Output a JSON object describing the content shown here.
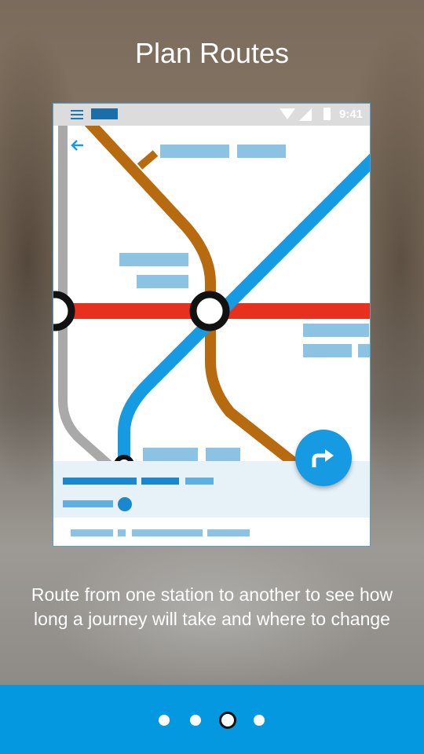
{
  "screen": {
    "title": "Plan Routes",
    "description": "Route from one station to another to see how long a journey will take and where to change"
  },
  "phone_mockup": {
    "status_time": "9:41",
    "icons": [
      "menu-icon",
      "wifi-icon",
      "signal-icon",
      "battery-icon",
      "back-arrow-icon",
      "directions-icon"
    ]
  },
  "page_indicator": {
    "total": 4,
    "active_index": 2
  },
  "colors": {
    "accent_blue": "#0398e0",
    "line_blue": "#169ae1",
    "line_red": "#e8301f",
    "line_brown": "#b86a0f",
    "line_gray": "#9e9e9e"
  }
}
